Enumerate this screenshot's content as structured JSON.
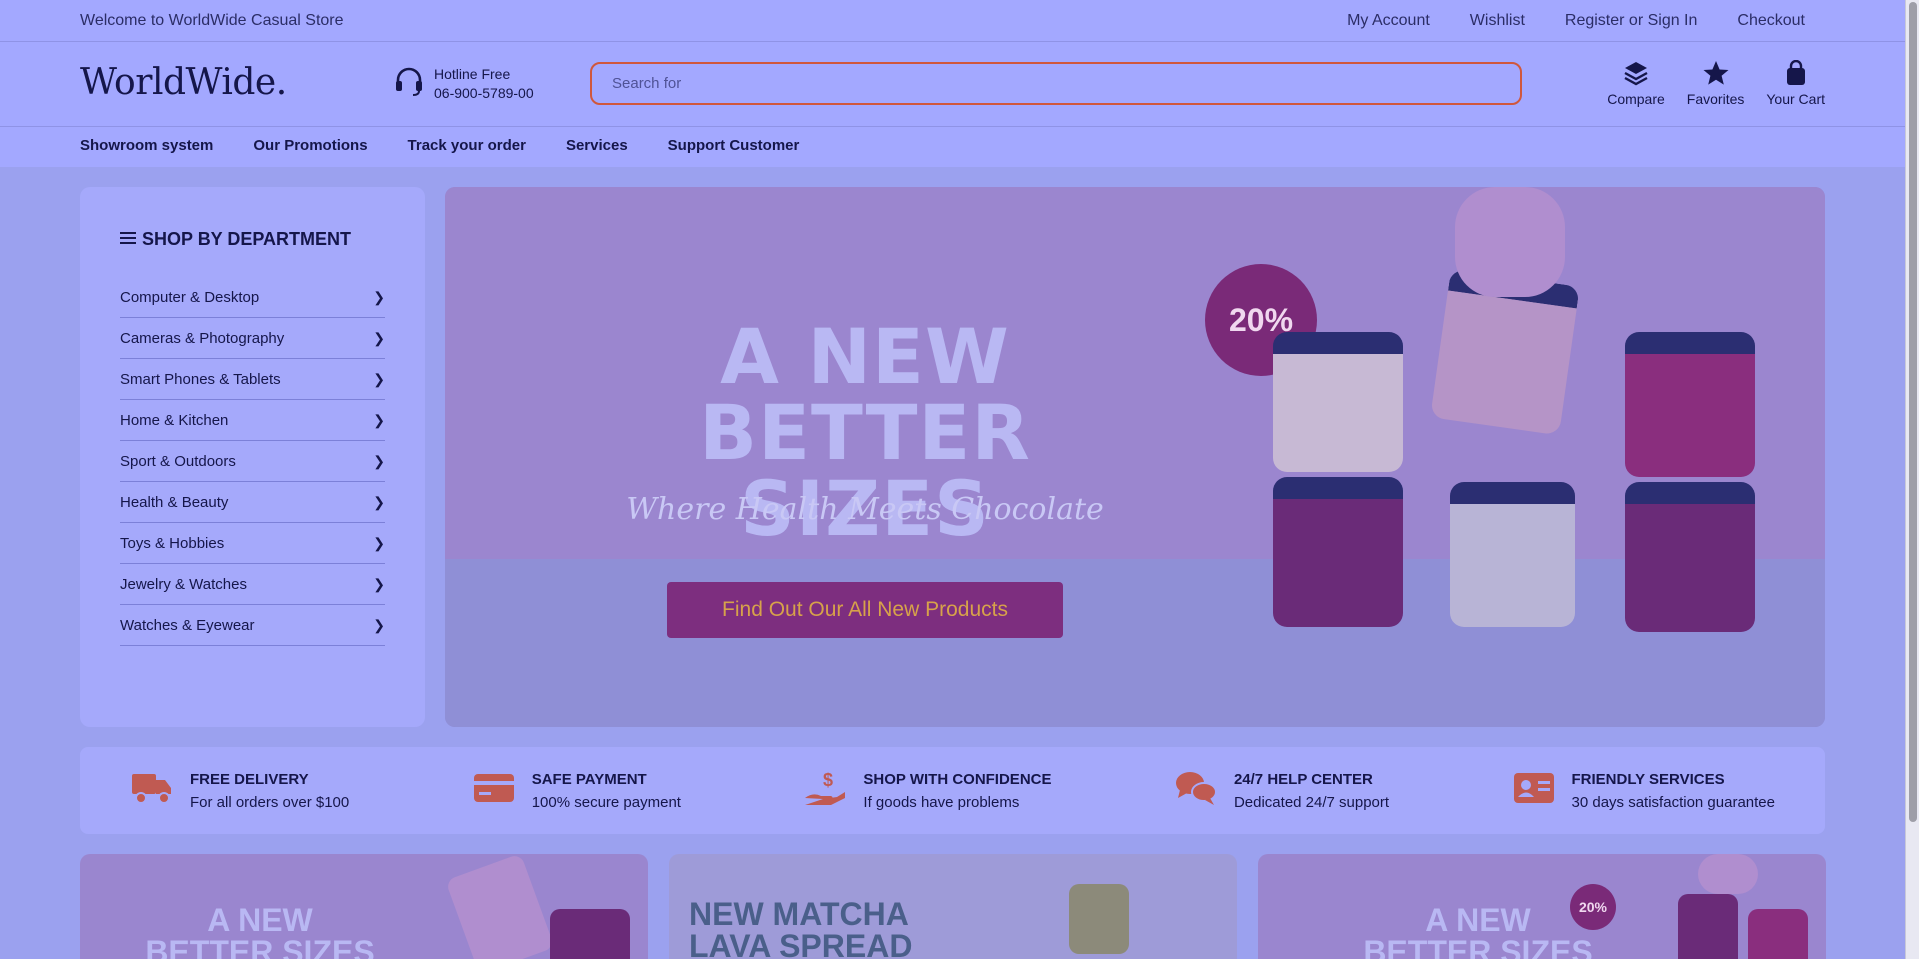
{
  "topbar": {
    "welcome": "Welcome to WorldWide Casual Store",
    "links": [
      "My Account",
      "Wishlist",
      "Register or Sign In",
      "Checkout"
    ]
  },
  "header": {
    "logo": "WorldWide.",
    "hotline_label": "Hotline Free",
    "hotline_number": "06-900-5789-00",
    "search_placeholder": "Search for",
    "icons": [
      {
        "label": "Compare",
        "icon": "layers-icon"
      },
      {
        "label": "Favorites",
        "icon": "star-icon"
      },
      {
        "label": "Your Cart",
        "icon": "bag-icon"
      }
    ]
  },
  "nav": {
    "items": [
      "Showroom system",
      "Our Promotions",
      "Track your order",
      "Services",
      "Support Customer"
    ]
  },
  "sidebar": {
    "title": "SHOP BY DEPARTMENT",
    "items": [
      "Computer & Desktop",
      "Cameras & Photography",
      "Smart Phones & Tablets",
      "Home & Kitchen",
      "Sport & Outdoors",
      "Health & Beauty",
      "Toys & Hobbies",
      "Jewelry & Watches",
      "Watches & Eyewear"
    ]
  },
  "hero": {
    "headline_1": "A NEW",
    "headline_2": "BETTER SIZES",
    "tagline": "Where Health Meets Chocolate",
    "cta": "Find Out Our All New Products",
    "badge": "20%"
  },
  "features": [
    {
      "title": "FREE DELIVERY",
      "subtitle": "For all orders over $100",
      "icon": "truck-icon"
    },
    {
      "title": "SAFE PAYMENT",
      "subtitle": "100% secure payment",
      "icon": "credit-card-icon"
    },
    {
      "title": "SHOP WITH CONFIDENCE",
      "subtitle": "If goods have problems",
      "icon": "hand-dollar-icon"
    },
    {
      "title": "24/7 HELP CENTER",
      "subtitle": "Dedicated 24/7 support",
      "icon": "chat-icon"
    },
    {
      "title": "FRIENDLY SERVICES",
      "subtitle": "30 days satisfaction guarantee",
      "icon": "id-card-icon"
    }
  ],
  "promos": [
    {
      "title_1": "A NEW",
      "title_2": "BETTER SIZES",
      "badge": ""
    },
    {
      "title_1": "NEW MATCHA",
      "title_2": "LAVA SPREAD",
      "badge": ""
    },
    {
      "title_1": "A NEW",
      "title_2": "BETTER SIZES",
      "badge": "20%"
    }
  ],
  "colors": {
    "accent": "#d0573c",
    "cta_bg": "#7d2e7f",
    "badge_bg": "#7a2a78"
  }
}
